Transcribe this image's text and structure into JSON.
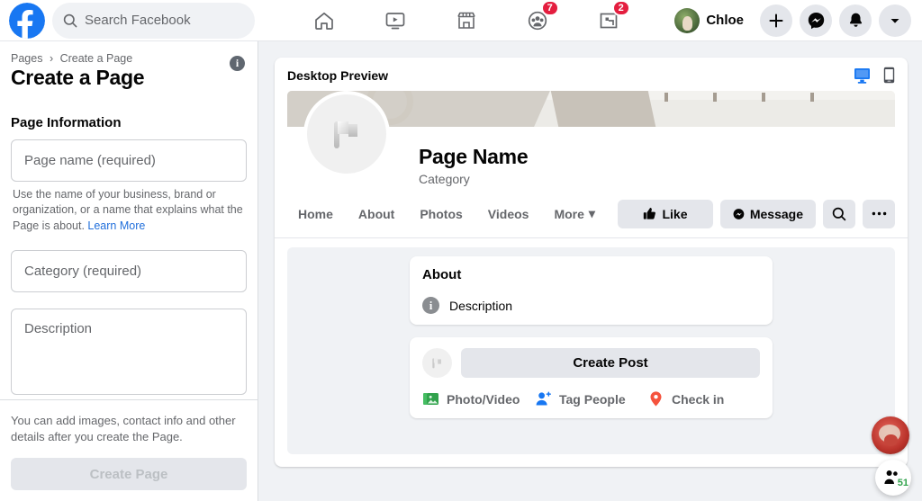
{
  "topbar": {
    "logo_icon": "facebook-logo-icon",
    "search": {
      "placeholder": "Search Facebook",
      "icon": "search-icon"
    },
    "nav": [
      {
        "name": "home",
        "icon": "home-icon",
        "badge": ""
      },
      {
        "name": "watch",
        "icon": "video-play-icon",
        "badge": ""
      },
      {
        "name": "marketplace",
        "icon": "store-icon",
        "badge": ""
      },
      {
        "name": "groups",
        "icon": "groups-icon",
        "badge": "7"
      },
      {
        "name": "gaming",
        "icon": "gaming-icon",
        "badge": "2"
      }
    ],
    "profile": {
      "name": "Chloe",
      "avatar_icon": "user-avatar"
    },
    "actions": [
      {
        "name": "create",
        "icon": "plus-icon"
      },
      {
        "name": "messenger",
        "icon": "messenger-icon"
      },
      {
        "name": "notifications",
        "icon": "bell-icon"
      },
      {
        "name": "account",
        "icon": "chevron-down-icon"
      }
    ]
  },
  "sidebar": {
    "breadcrumb": {
      "root": "Pages",
      "separator": "›",
      "current": "Create a Page"
    },
    "title": "Create a Page",
    "info_icon": "info-icon",
    "section_heading": "Page Information",
    "fields": {
      "page_name": {
        "placeholder": "Page name (required)",
        "value": ""
      },
      "category": {
        "placeholder": "Category (required)",
        "value": ""
      },
      "description": {
        "placeholder": "Description",
        "value": ""
      }
    },
    "helper_text": "Use the name of your business, brand or organization, or a name that explains what the Page is about.",
    "helper_link": "Learn More",
    "footer_note": "You can add images, contact info and other details after you create the Page.",
    "create_button": "Create Page"
  },
  "preview": {
    "title": "Desktop Preview",
    "view_icons": [
      {
        "name": "desktop-view",
        "icon": "monitor-icon",
        "active": true,
        "color": "#1877f2"
      },
      {
        "name": "mobile-view",
        "icon": "mobile-icon",
        "active": false,
        "color": "#4b4f56"
      }
    ],
    "page": {
      "avatar_icon": "flag-placeholder-icon",
      "name": "Page Name",
      "category": "Category",
      "tabs": [
        {
          "label": "Home"
        },
        {
          "label": "About"
        },
        {
          "label": "Photos"
        },
        {
          "label": "Videos"
        },
        {
          "label": "More",
          "caret": "▾"
        }
      ],
      "actions": [
        {
          "name": "like",
          "label": "Like",
          "icon": "thumbs-up-icon"
        },
        {
          "name": "message",
          "label": "Message",
          "icon": "messenger-icon"
        },
        {
          "name": "search",
          "label": "",
          "icon": "search-icon"
        },
        {
          "name": "more-options",
          "label": "···",
          "icon": "ellipsis-icon"
        }
      ]
    },
    "about_card": {
      "heading": "About",
      "row_icon": "info-icon",
      "row_label": "Description"
    },
    "composer": {
      "avatar_icon": "flag-placeholder-icon",
      "prompt": "Create Post",
      "actions": [
        {
          "name": "photo-video",
          "label": "Photo/Video",
          "icon": "photo-icon",
          "color": "#45bd62"
        },
        {
          "name": "tag-people",
          "label": "Tag People",
          "icon": "tag-person-icon",
          "color": "#1877f2"
        },
        {
          "name": "check-in",
          "label": "Check in",
          "icon": "location-pin-icon",
          "color": "#f5533d"
        }
      ]
    }
  },
  "floating": {
    "chat_avatar_icon": "contact-avatar",
    "contacts_icon": "contacts-icon",
    "contacts_count": "51",
    "contacts_count_color": "#31a24c"
  }
}
